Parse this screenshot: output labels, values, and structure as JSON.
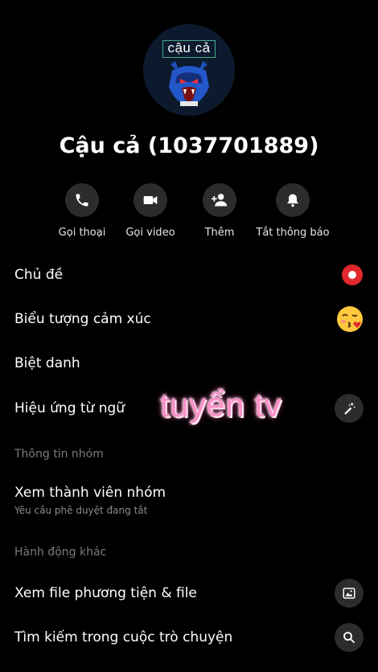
{
  "avatar": {
    "overlay_text": "cậu cả"
  },
  "profile": {
    "name": "Cậu cả (1037701889)"
  },
  "actions": [
    {
      "label": "Gọi thoại",
      "icon": "phone-icon"
    },
    {
      "label": "Gọi video",
      "icon": "video-icon"
    },
    {
      "label": "Thêm",
      "icon": "add-person-icon"
    },
    {
      "label": "Tắt thông báo",
      "icon": "bell-icon"
    }
  ],
  "settings": {
    "theme": {
      "label": "Chủ đề",
      "icon": "theme-dot-icon",
      "accent": "#e0282d"
    },
    "emoji": {
      "label": "Biểu tượng cảm xúc",
      "icon": "kiss-emoji-icon"
    },
    "nickname": {
      "label": "Biệt danh"
    },
    "word_effects": {
      "label": "Hiệu ứng từ ngữ",
      "icon": "magic-wand-icon"
    }
  },
  "sections": {
    "group_info": "Thông tin nhóm",
    "other_actions": "Hành động khác"
  },
  "group": {
    "view_members": "Xem thành viên nhóm",
    "approval_status": "Yêu cầu phê duyệt đang tắt"
  },
  "other": {
    "view_media": {
      "label": "Xem file phương tiện & file",
      "icon": "image-icon"
    },
    "search_chat": {
      "label": "Tìm kiếm trong cuộc trò chuyện",
      "icon": "search-icon"
    }
  },
  "overlay": {
    "text": "tuyển tv"
  }
}
